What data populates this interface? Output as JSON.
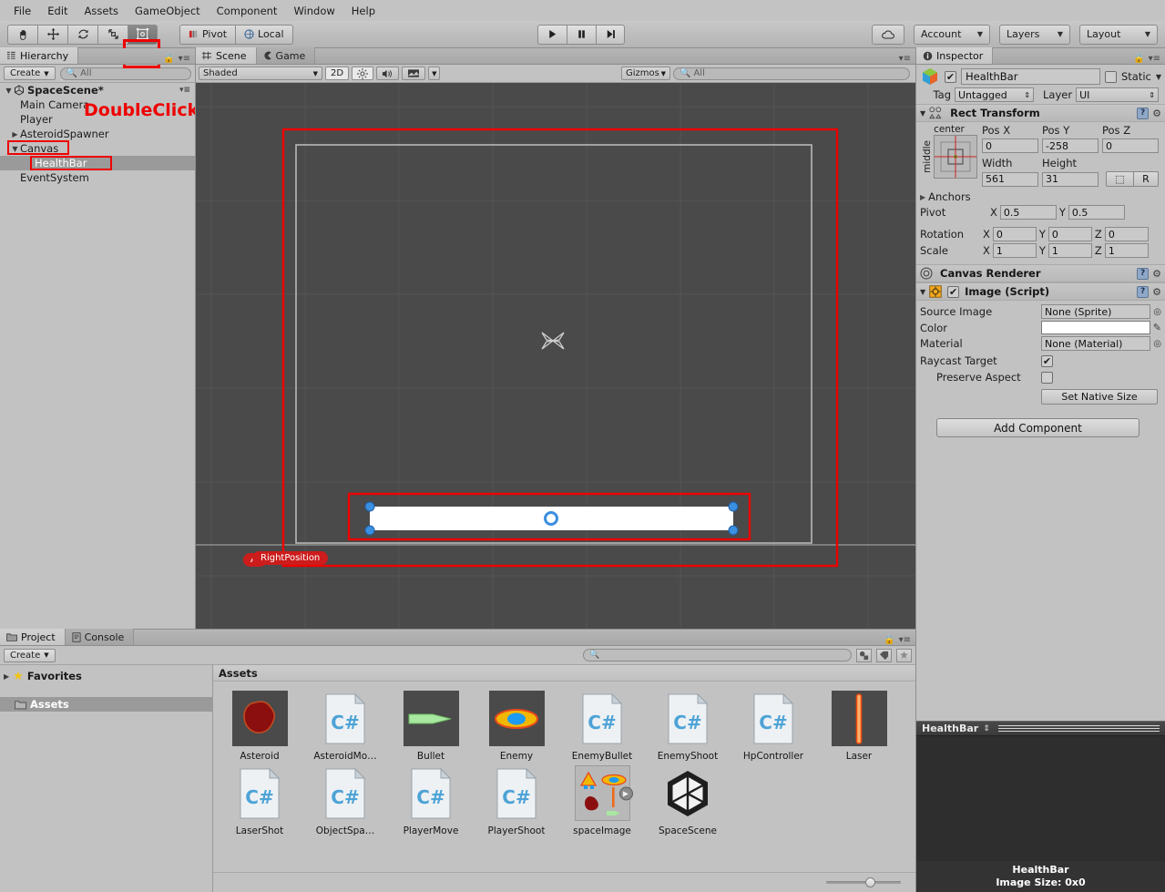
{
  "menu": {
    "items": [
      "File",
      "Edit",
      "Assets",
      "GameObject",
      "Component",
      "Window",
      "Help"
    ]
  },
  "toolbar": {
    "tools": [
      {
        "name": "hand-tool",
        "glyph": "✋"
      },
      {
        "name": "move-tool",
        "glyph": "✥"
      },
      {
        "name": "rotate-tool",
        "glyph": "⟳"
      },
      {
        "name": "scale-tool",
        "glyph": "⤢"
      },
      {
        "name": "rect-tool",
        "glyph": "▣"
      }
    ],
    "pivot_label": "Pivot",
    "local_label": "Local",
    "play_label": "▶",
    "pause_label": "❙❙",
    "step_label": "▶❙",
    "cloud_label": "☁",
    "account_label": "Account",
    "layers_label": "Layers",
    "layout_label": "Layout"
  },
  "hierarchy": {
    "tab_label": "Hierarchy",
    "create_label": "Create",
    "search_placeholder": "All",
    "annotation": "DoubleClick",
    "items": [
      {
        "label": "SpaceScene*",
        "depth": 0,
        "arrow": "▼",
        "scene": true,
        "selected": false
      },
      {
        "label": "Main Camera",
        "depth": 1,
        "arrow": "",
        "scene": false,
        "selected": false
      },
      {
        "label": "Player",
        "depth": 1,
        "arrow": "",
        "scene": false,
        "selected": false
      },
      {
        "label": "AsteroidSpawner",
        "depth": 1,
        "arrow": "▶",
        "scene": false,
        "selected": false
      },
      {
        "label": "Canvas",
        "depth": 1,
        "arrow": "▼",
        "scene": false,
        "selected": false
      },
      {
        "label": "HealthBar",
        "depth": 2,
        "arrow": "",
        "scene": false,
        "selected": true
      },
      {
        "label": "EventSystem",
        "depth": 1,
        "arrow": "",
        "scene": false,
        "selected": false
      }
    ]
  },
  "scene": {
    "tab_scene": "Scene",
    "tab_game": "Game",
    "shading_mode": "Shaded",
    "mode_2d": "2D",
    "light_icon": "☀",
    "audio_icon": "🔊",
    "fx_icon": "▣",
    "gizmos_label": "Gizmos",
    "search_placeholder": "All",
    "gizmo_labels": [
      "A.",
      "RightPosition"
    ]
  },
  "project": {
    "tab_project": "Project",
    "tab_console": "Console",
    "create_label": "Create",
    "search_placeholder": "",
    "favorites_label": "Favorites",
    "assets_tree_label": "Assets",
    "breadcrumb": "Assets",
    "items": [
      {
        "name": "Asteroid",
        "kind": "asteroid"
      },
      {
        "name": "AsteroidMo…",
        "kind": "csharp"
      },
      {
        "name": "Bullet",
        "kind": "bullet"
      },
      {
        "name": "Enemy",
        "kind": "enemy"
      },
      {
        "name": "EnemyBullet",
        "kind": "csharp"
      },
      {
        "name": "EnemyShoot",
        "kind": "csharp"
      },
      {
        "name": "HpController",
        "kind": "csharp"
      },
      {
        "name": "Laser",
        "kind": "laser"
      },
      {
        "name": "LaserShot",
        "kind": "csharp"
      },
      {
        "name": "ObjectSpa…",
        "kind": "csharp"
      },
      {
        "name": "PlayerMove",
        "kind": "csharp"
      },
      {
        "name": "PlayerShoot",
        "kind": "csharp"
      },
      {
        "name": "spaceImage",
        "kind": "atlas"
      },
      {
        "name": "SpaceScene",
        "kind": "unity"
      }
    ]
  },
  "inspector": {
    "tab_label": "Inspector",
    "object_name": "HealthBar",
    "static_label": "Static",
    "tag_label": "Tag",
    "tag_value": "Untagged",
    "layer_label": "Layer",
    "layer_value": "UI",
    "rect_transform": {
      "title": "Rect Transform",
      "anchor_preset_h": "center",
      "anchor_preset_v": "middle",
      "pos_x_label": "Pos X",
      "pos_y_label": "Pos Y",
      "pos_z_label": "Pos Z",
      "pos_x": "0",
      "pos_y": "-258",
      "pos_z": "0",
      "width_label": "Width",
      "height_label": "Height",
      "width": "561",
      "height": "31",
      "blueprint_label": "⬚",
      "raw_label": "R",
      "anchors_label": "Anchors",
      "pivot_label": "Pivot",
      "pivot_x": "0.5",
      "pivot_y": "0.5",
      "rotation_label": "Rotation",
      "rotation_x": "0",
      "rotation_y": "0",
      "rotation_z": "0",
      "scale_label": "Scale",
      "scale_x": "1",
      "scale_y": "1",
      "scale_z": "1",
      "x_label": "X",
      "y_label": "Y",
      "z_label": "Z"
    },
    "canvas_renderer": {
      "title": "Canvas Renderer"
    },
    "image_script": {
      "title": "Image (Script)",
      "source_image_label": "Source Image",
      "source_image_value": "None (Sprite)",
      "color_label": "Color",
      "color_value": "#FFFFFF",
      "material_label": "Material",
      "material_value": "None (Material)",
      "raycast_target_label": "Raycast Target",
      "preserve_aspect_label": "Preserve Aspect",
      "set_native_size_label": "Set Native Size"
    },
    "add_component_label": "Add Component"
  },
  "preview": {
    "title": "HealthBar",
    "footer_name": "HealthBar",
    "footer_size": "Image Size: 0x0"
  },
  "colors": {
    "annotation_red": "#ee0000",
    "scene_bg": "#4a4a4a",
    "panel_bg": "#c2c2c2",
    "selection": "#9a9a9a",
    "handle_blue": "#2a7fd4"
  }
}
